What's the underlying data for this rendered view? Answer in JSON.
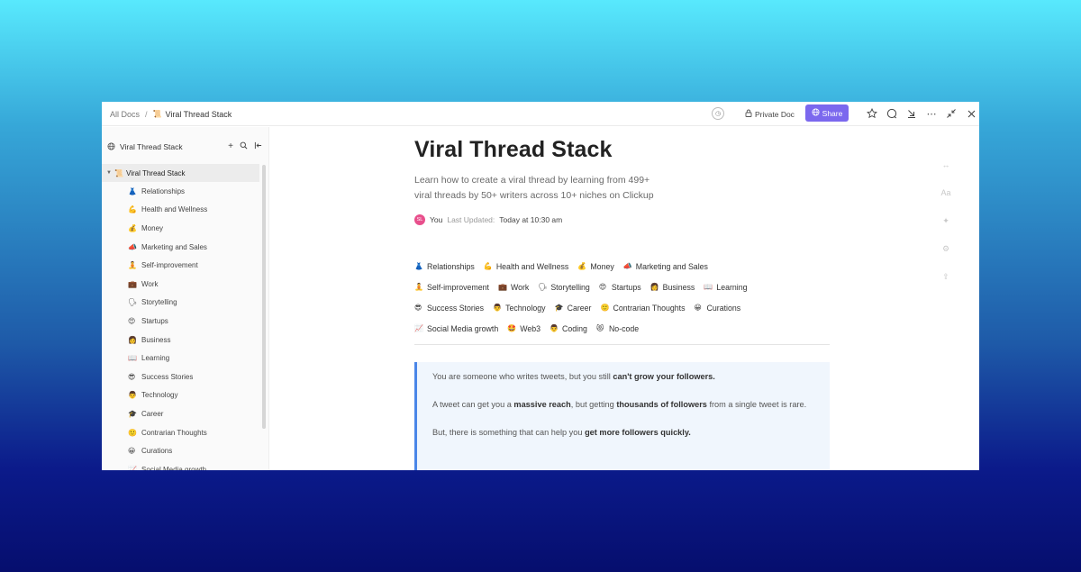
{
  "breadcrumb": {
    "all_docs": "All Docs",
    "separator": "/",
    "current": "Viral Thread Stack",
    "current_icon": "scroll-emoji"
  },
  "toolbar": {
    "history_icon": "clock-icon",
    "private_doc": "Private Doc",
    "share": "Share",
    "icons": [
      "star-icon",
      "comment-icon",
      "download-icon",
      "more-icon",
      "collapse-icon",
      "close-icon"
    ]
  },
  "sidebar": {
    "header": "Viral Thread Stack",
    "root_item": {
      "label": "Viral Thread Stack",
      "emoji": "📜"
    },
    "items": [
      {
        "label": "Relationships",
        "emoji": "👗"
      },
      {
        "label": "Health and Wellness",
        "emoji": "💪"
      },
      {
        "label": "Money",
        "emoji": "💰"
      },
      {
        "label": "Marketing and Sales",
        "emoji": "📣"
      },
      {
        "label": "Self-improvement",
        "emoji": "🧘"
      },
      {
        "label": "Work",
        "emoji": "💼"
      },
      {
        "label": "Storytelling",
        "emoji": "🗣"
      },
      {
        "label": "Startups",
        "emoji": "😍"
      },
      {
        "label": "Business",
        "emoji": "👩"
      },
      {
        "label": "Learning",
        "emoji": "📖"
      },
      {
        "label": "Success Stories",
        "emoji": "😎"
      },
      {
        "label": "Technology",
        "emoji": "👨"
      },
      {
        "label": "Career",
        "emoji": "🎓"
      },
      {
        "label": "Contrarian Thoughts",
        "emoji": "🙂"
      },
      {
        "label": "Curations",
        "emoji": "😀"
      },
      {
        "label": "Social Media growth",
        "emoji": "📈"
      }
    ]
  },
  "doc": {
    "title": "Viral Thread Stack",
    "subtitle": "Learn how to create a viral thread by learning from 499+ viral threads by 50+ writers across 10+ niches on Clickup",
    "avatar_initials": "SL",
    "author": "You",
    "last_updated_label": "Last Updated:",
    "last_updated_value": "Today at 10:30 am",
    "tags": [
      [
        {
          "label": "Relationships",
          "emoji": "👗"
        },
        {
          "label": "Health and Wellness",
          "emoji": "💪"
        },
        {
          "label": "Money",
          "emoji": "💰"
        },
        {
          "label": "Marketing and Sales",
          "emoji": "📣"
        }
      ],
      [
        {
          "label": "Self-improvement",
          "emoji": "🧘"
        },
        {
          "label": "Work",
          "emoji": "💼"
        },
        {
          "label": "Storytelling",
          "emoji": "🗣"
        },
        {
          "label": "Startups",
          "emoji": "😍"
        },
        {
          "label": "Business",
          "emoji": "👩"
        },
        {
          "label": "Learning",
          "emoji": "📖"
        }
      ],
      [
        {
          "label": "Success Stories",
          "emoji": "😎"
        },
        {
          "label": "Technology",
          "emoji": "👨"
        },
        {
          "label": "Career",
          "emoji": "🎓"
        },
        {
          "label": "Contrarian Thoughts",
          "emoji": "🙂"
        },
        {
          "label": "Curations",
          "emoji": "😀"
        }
      ],
      [
        {
          "label": "Social Media growth",
          "emoji": "📈"
        },
        {
          "label": "Web3",
          "emoji": "🤩"
        },
        {
          "label": "Coding",
          "emoji": "👨"
        },
        {
          "label": "No-code",
          "emoji": "😻"
        }
      ]
    ],
    "callout": [
      {
        "pre": "You are someone who writes tweets, but you still ",
        "bold": "can't grow your followers.",
        "mid": "",
        "bold2": "",
        "post": ""
      },
      {
        "pre": "A tweet can get you a ",
        "bold": "massive reach",
        "mid": ", but getting ",
        "bold2": "thousands of followers",
        "post": " from a single tweet is rare."
      },
      {
        "pre": "But, there is something that can help you ",
        "bold": "get more followers quickly.",
        "mid": "",
        "bold2": "",
        "post": ""
      }
    ]
  },
  "right_rail": [
    "width-icon",
    "font-icon",
    "magic-icon",
    "settings-icon",
    "export-icon"
  ]
}
